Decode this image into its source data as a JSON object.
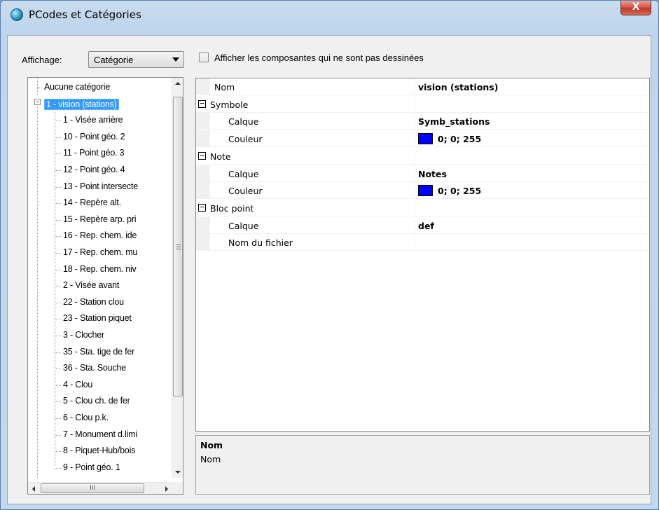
{
  "window": {
    "title": "PCodes et Catégories",
    "close_glyph": "X"
  },
  "toolbar": {
    "display_label": "Affichage:",
    "display_value": "Catégorie",
    "show_hidden_label": "Afficher les composantes qui ne sont pas dessinées",
    "show_hidden_checked": false
  },
  "tree": {
    "items": [
      {
        "label": "Aucune catégorie"
      },
      {
        "label": "1 - vision (stations)",
        "selected": true,
        "expanded": true
      },
      {
        "label": "1 - Visée arrière"
      },
      {
        "label": "10 - Point géo. 2"
      },
      {
        "label": "11 - Point géo. 3"
      },
      {
        "label": "12 - Point géo. 4"
      },
      {
        "label": "13 - Point intersecte"
      },
      {
        "label": "14 - Repère alt."
      },
      {
        "label": "15 - Repère arp. pri"
      },
      {
        "label": "16 - Rep. chem. ide"
      },
      {
        "label": "17 - Rep. chem. mu"
      },
      {
        "label": "18 - Rep. chem. niv"
      },
      {
        "label": "2 - Visée avant"
      },
      {
        "label": "22 - Station clou"
      },
      {
        "label": "23 - Station piquet"
      },
      {
        "label": "3 - Clocher"
      },
      {
        "label": "35 - Sta. tige de fer"
      },
      {
        "label": "36 - Sta. Souche"
      },
      {
        "label": "4 - Clou"
      },
      {
        "label": "5 - Clou ch. de fer"
      },
      {
        "label": "6 - Clou p.k."
      },
      {
        "label": "7 - Monument d.limi"
      },
      {
        "label": "8 - Piquet-Hub/bois"
      },
      {
        "label": "9 - Point géo. 1"
      }
    ],
    "hscroll_grip": "III"
  },
  "properties": {
    "rows": [
      {
        "kind": "top",
        "name": "Nom",
        "value": "vision (stations)"
      },
      {
        "kind": "cat",
        "name": "Symbole"
      },
      {
        "kind": "prop",
        "name": "Calque",
        "value": "Symb_stations"
      },
      {
        "kind": "prop",
        "name": "Couleur",
        "value": "0; 0; 255",
        "color": "#0000ff"
      },
      {
        "kind": "cat",
        "name": "Note"
      },
      {
        "kind": "prop",
        "name": "Calque",
        "value": "Notes"
      },
      {
        "kind": "prop",
        "name": "Couleur",
        "value": "0; 0; 255",
        "color": "#0000ff"
      },
      {
        "kind": "cat",
        "name": "Bloc point"
      },
      {
        "kind": "prop",
        "name": "Calque",
        "value": "def"
      },
      {
        "kind": "prop",
        "name": "Nom du fichier",
        "value": ""
      }
    ],
    "collapse_glyph": "−"
  },
  "help": {
    "title": "Nom",
    "description": "Nom"
  },
  "icons": {
    "app": "globe-icon",
    "close": "close-icon",
    "dropdown": "chevron-down-icon",
    "cursor": "mouse-pointer-icon"
  }
}
